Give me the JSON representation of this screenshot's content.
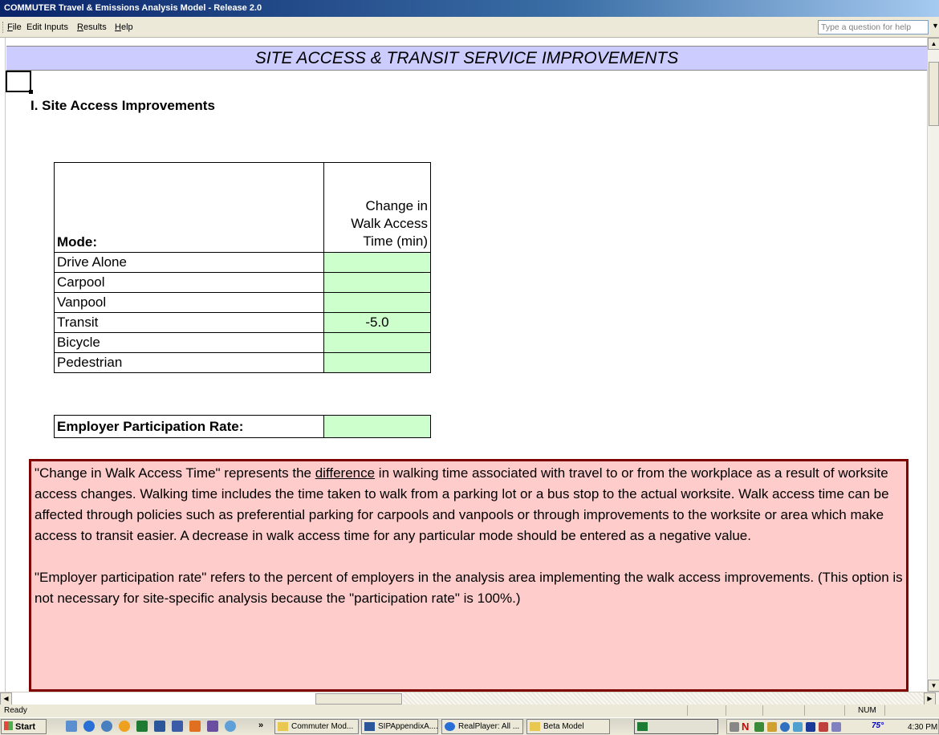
{
  "window": {
    "title": "COMMUTER Travel & Emissions Analysis Model - Release 2.0"
  },
  "menu": {
    "items": [
      {
        "accel": "F",
        "rest": "ile"
      },
      {
        "accel": "",
        "rest": "Edit Inputs"
      },
      {
        "accel": "R",
        "rest": "esults"
      },
      {
        "accel": "H",
        "rest": "elp"
      }
    ],
    "help_placeholder": "Type a question for help"
  },
  "sheet": {
    "header": "SITE ACCESS & TRANSIT SERVICE IMPROVEMENTS",
    "subtitle": "I. Site Access Improvements",
    "table": {
      "mode_header": "Mode:",
      "value_header_lines": [
        "Change in",
        "Walk Access",
        "Time (min)"
      ],
      "rows": [
        {
          "mode": "Drive Alone",
          "value": ""
        },
        {
          "mode": "Carpool",
          "value": ""
        },
        {
          "mode": "Vanpool",
          "value": ""
        },
        {
          "mode": "Transit",
          "value": "-5.0"
        },
        {
          "mode": "Bicycle",
          "value": ""
        },
        {
          "mode": "Pedestrian",
          "value": ""
        }
      ]
    },
    "participation": {
      "label": "Employer Participation Rate:",
      "value": ""
    },
    "note": {
      "p1_before": "\"Change in Walk Access Time\" represents the ",
      "p1_underlined": "difference",
      "p1_after": " in walking time associated with travel to or from the workplace as a result of worksite access changes.  Walking time includes the time taken to walk from a parking lot or a bus stop to the actual worksite. Walk access time can be affected through policies such as preferential parking for carpools and vanpools or through improvements to the worksite or area which make access to transit easier.  A decrease in walk access time for any particular mode should be entered as a negative value.",
      "p2": "\"Employer participation rate\" refers to the percent of employers in the analysis area implementing the walk access improvements.  (This option is not necessary for site-specific analysis because the \"participation rate\" is 100%.)"
    }
  },
  "status": {
    "left": "Ready",
    "num": "NUM"
  },
  "taskbar": {
    "start": "Start",
    "more": "»",
    "tasks": [
      {
        "label": "Commuter Mod...",
        "icon": "folder-icon"
      },
      {
        "label": "SIPAppendixA....",
        "icon": "word-icon"
      },
      {
        "label": "RealPlayer: All ...",
        "icon": "realplayer-icon"
      },
      {
        "label": "Beta Model",
        "icon": "folder-icon"
      },
      {
        "label": "",
        "icon": "excel-icon"
      }
    ],
    "temperature": "75°",
    "time": "4:30 PM"
  },
  "colors": {
    "header_bg": "#ccccff",
    "input_cell": "#ccffcc",
    "note_bg": "#ffcccc",
    "note_border": "#800000"
  }
}
